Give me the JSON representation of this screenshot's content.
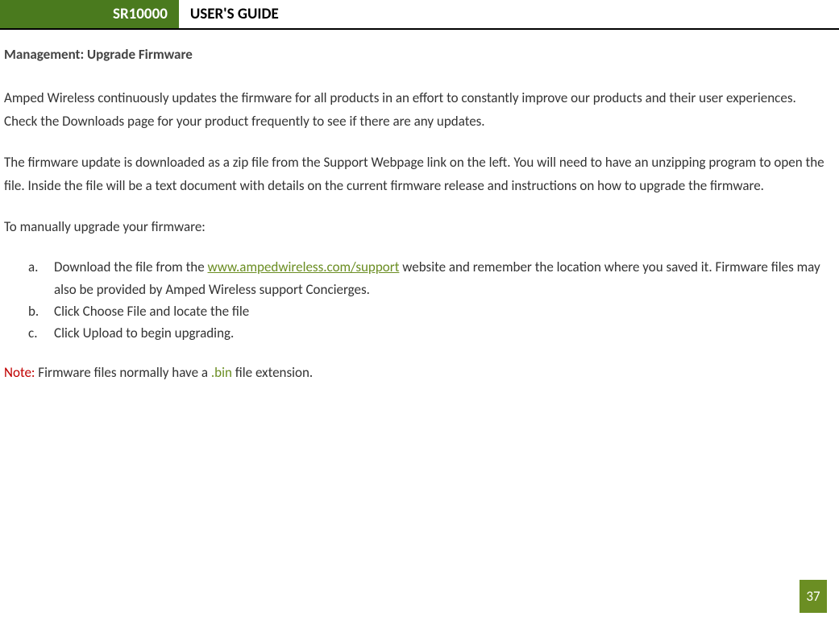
{
  "header": {
    "model": "SR10000",
    "title": "USER'S GUIDE"
  },
  "section_title": "Management: Upgrade Firmware",
  "para1": "Amped Wireless continuously updates the firmware for all products in an effort to constantly improve our products and their user experiences.  Check the Downloads page for your product frequently to see if there are any updates.",
  "para2": "The firmware update is downloaded as a zip file from the Support Webpage link on the left.  You will need to have an unzipping program to open the file.  Inside the file will be a text document with details on the current firmware release and instructions on how to upgrade the firmware.",
  "para3": "To manually upgrade your firmware:",
  "list": {
    "a": {
      "marker": "a.",
      "pre": "Download the file from the ",
      "link": "www.ampedwireless.com/support",
      "post": " website and remember the location where you saved it.  Firmware files may also be provided by Amped Wireless support Concierges."
    },
    "b": {
      "marker": "b.",
      "text": "Click Choose File and locate the file"
    },
    "c": {
      "marker": "c.",
      "text": "Click Upload to begin upgrading."
    }
  },
  "note": {
    "label": "Note:",
    "pre": " Firmware files normally have a ",
    "ext": ".bin",
    "post": " file extension."
  },
  "page_number": "37"
}
